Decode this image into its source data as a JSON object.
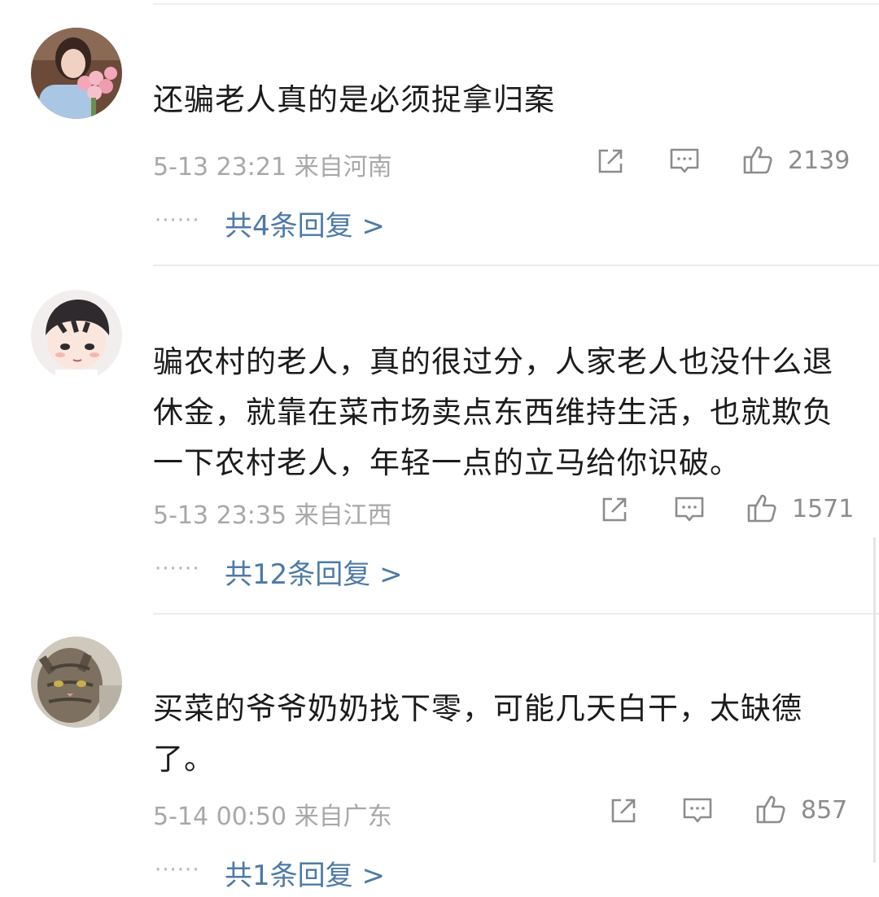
{
  "comments": [
    {
      "avatar": "woman-with-flowers-avatar",
      "text": "还骗老人真的是必须捉拿归案",
      "time": "5-13 23:21 来自河南",
      "likes": "2139",
      "replies": "共4条回复 >"
    },
    {
      "avatar": "cartoon-boy-avatar",
      "text": "骗农村的老人，真的很过分，人家老人也没什么退休金，就靠在菜市场卖点东西维持生活，也就欺负一下农村老人，年轻一点的立马给你识破。",
      "time": "5-13 23:35 来自江西",
      "likes": "1571",
      "replies": "共12条回复 >"
    },
    {
      "avatar": "tabby-cat-avatar",
      "text": "买菜的爷爷奶奶找下零，可能几天白干，太缺德了。",
      "time": "5-14 00:50 来自广东",
      "likes": "857",
      "replies": "共1条回复 >"
    }
  ],
  "reply_dots": "······",
  "icons": {
    "share": "share-icon",
    "comment": "comment-icon",
    "like": "thumbs-up-icon"
  },
  "colors": {
    "text": "#1b1b1b",
    "meta": "#a8a8a8",
    "link": "#4d7aa6",
    "divider": "#ececec"
  }
}
